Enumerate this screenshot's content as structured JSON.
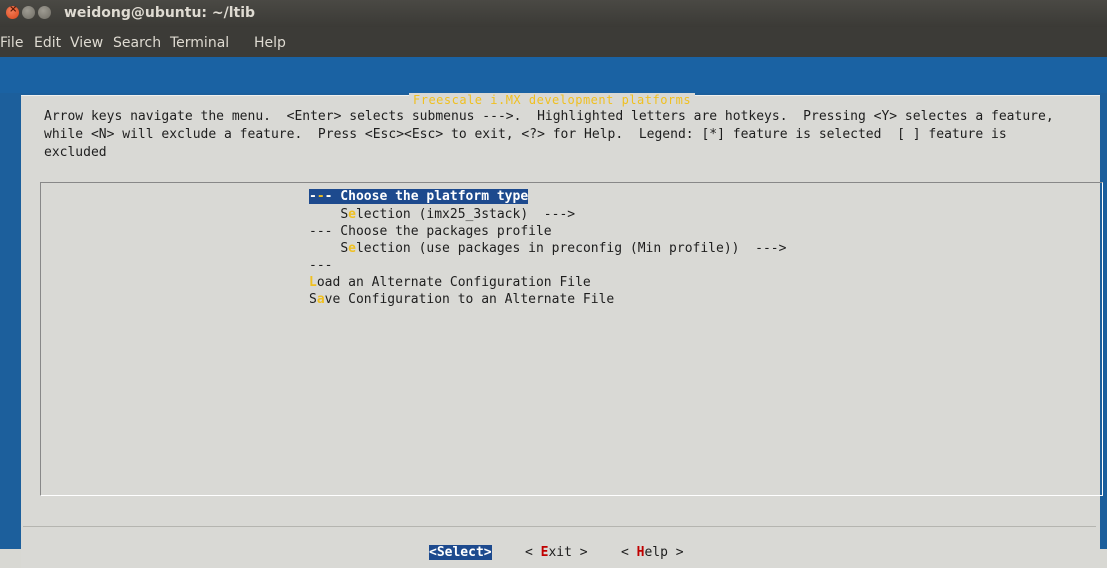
{
  "window": {
    "title": "weidong@ubuntu: ~/ltib"
  },
  "menubar": {
    "items": [
      "File",
      "Edit",
      "View",
      "Search",
      "Terminal",
      "Help"
    ]
  },
  "dialog": {
    "title": "Freescale i.MX development platforms",
    "help_lines": [
      "Arrow keys navigate the menu.  <Enter> selects submenus --->.  Highlighted letters are hotkeys.  Pressing <Y> selectes a feature,",
      "while <N> will exclude a feature.  Press <Esc><Esc> to exit, <?> for Help.  Legend: [*] feature is selected  [ ] feature is",
      "excluded"
    ],
    "menu": {
      "item0": {
        "prefix": "-",
        "hotkey": "-",
        "rest": "- Choose the platform type"
      },
      "item1": {
        "indent": "    ",
        "prefix": "S",
        "hotkey": "e",
        "rest": "lection (imx25_3stack)  --->"
      },
      "item2": {
        "text": "--- Choose the packages profile"
      },
      "item3": {
        "indent": "    ",
        "prefix": "S",
        "hotkey": "e",
        "rest": "lection (use packages in preconfig (Min profile))  --->"
      },
      "item4": {
        "text": "---"
      },
      "item5": {
        "hotkey": "L",
        "rest": "oad an Alternate Configuration File"
      },
      "item6": {
        "prefix": "S",
        "hotkey": "a",
        "rest": "ve Configuration to an Alternate File"
      }
    },
    "buttons": {
      "select": "<Select>",
      "exit_open": "< ",
      "exit_hot": "E",
      "exit_rest": "xit >",
      "help_open": "< ",
      "help_hot": "H",
      "help_rest": "elp >"
    }
  },
  "colors": {
    "terminal_bg": "#1c5f9c",
    "dialog_bg": "#d9d9d5",
    "highlight": "#1d4a8e",
    "hotkey": "#f0c020",
    "hotkey_button": "#c00000"
  }
}
